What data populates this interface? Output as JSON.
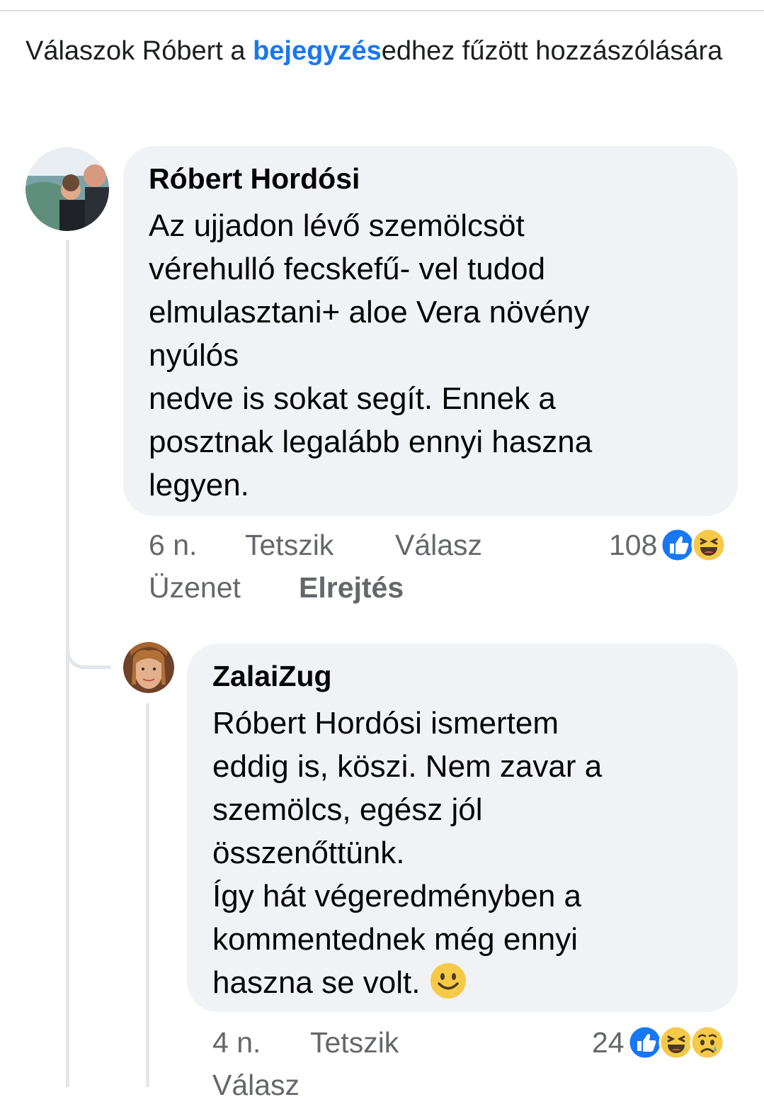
{
  "header": {
    "prefix": "Válaszok Róbert a ",
    "link": "bejegyzés",
    "suffix": "edhez fűzött hozzászólására"
  },
  "comments": [
    {
      "author": "Róbert Hordósi",
      "text": "Az ujjadon lévő szemölcsöt\nvérehulló fecskefű- vel tudod\nelmulasztani+ aloe Vera növény\nnyúlós\nnedve is sokat segít. Ennek a\nposztnak legalább ennyi haszna\nlegyen.",
      "time": "6 n.",
      "like": "Tetszik",
      "reply": "Válasz",
      "message": "Üzenet",
      "hide": "Elrejtés",
      "reaction_count": "108",
      "reactions": [
        "like-icon",
        "haha-icon"
      ]
    },
    {
      "author": "ZalaiZug",
      "text": "Róbert Hordósi ismertem\neddig is, köszi. Nem zavar a\nszemölcs, egész jól\nösszenőttünk.\nÍgy hát végeredményben a\nkommentednek még ennyi\nhaszna se volt. ",
      "time": "4 n.",
      "like": "Tetszik",
      "reply": "Válasz",
      "reaction_count": "24",
      "reactions": [
        "like-icon",
        "haha-icon",
        "sad-icon"
      ]
    }
  ],
  "colors": {
    "link": "#1877f2",
    "bubble": "#f0f2f5",
    "secondary_text": "#65676b"
  }
}
